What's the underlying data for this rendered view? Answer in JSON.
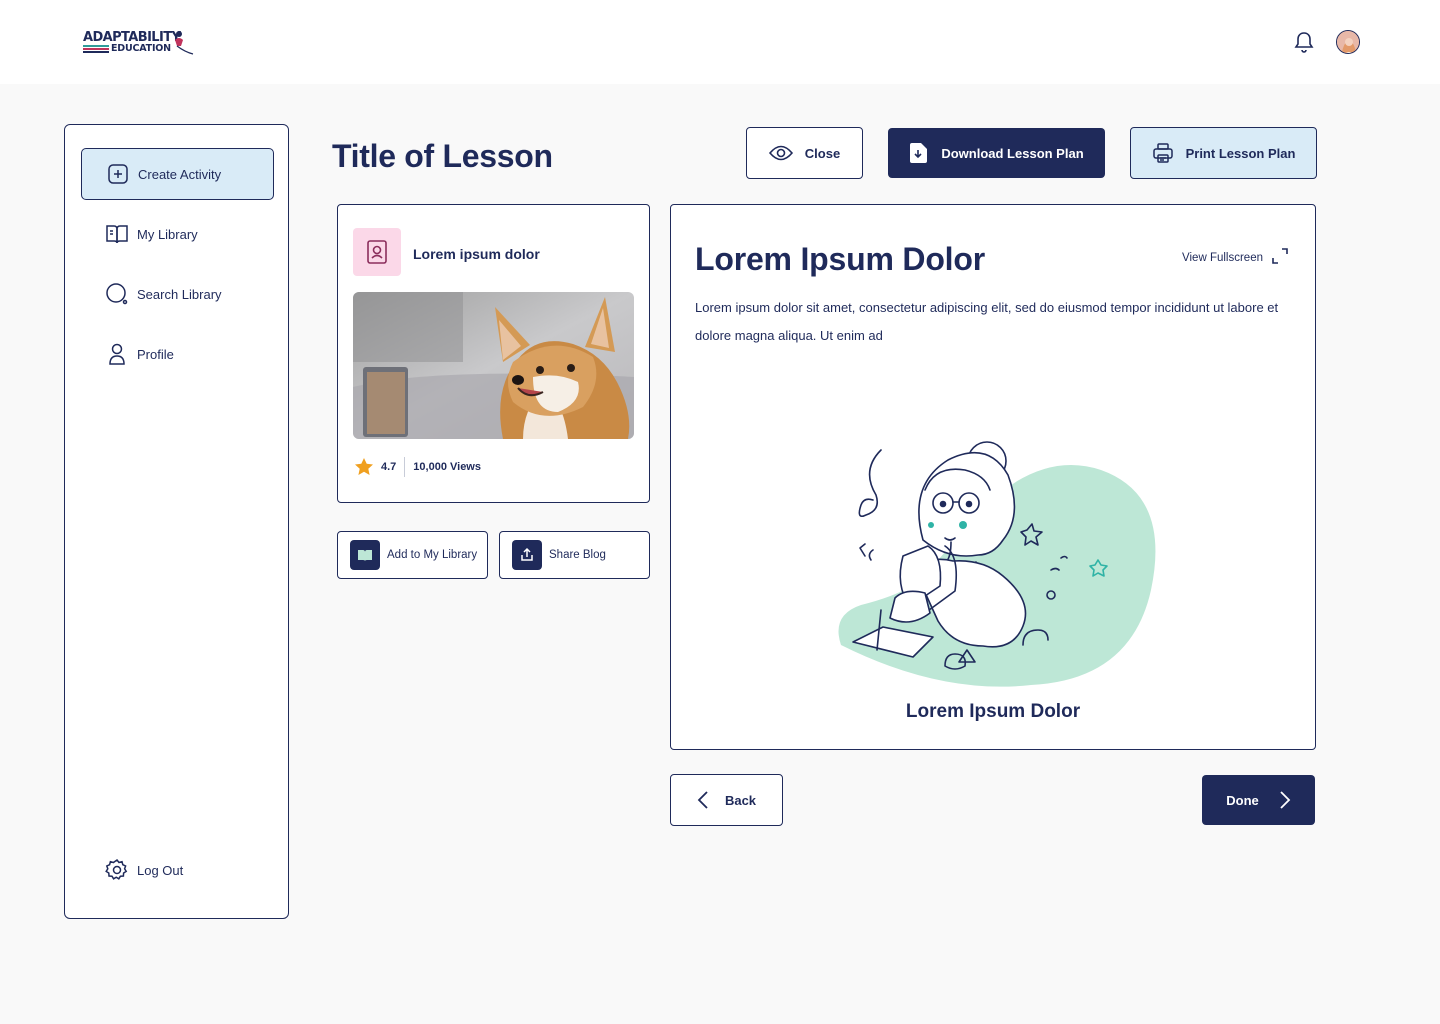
{
  "brand": {
    "logo_line1": "ADAPTABILITY",
    "logo_line2": "EDUCATION",
    "colors": {
      "navy": "#1f2a5a",
      "light_blue": "#d9ebf7",
      "mint": "#bde7d6",
      "pink": "#fbd8e8",
      "teal_bar": "#2f9c9a",
      "red_bar": "#c0335c"
    }
  },
  "header": {
    "notification_icon": "bell-icon",
    "avatar": "user-avatar"
  },
  "sidebar": {
    "items": [
      {
        "label": "Create Activity",
        "icon": "plus-square-icon",
        "active": true
      },
      {
        "label": "My Library",
        "icon": "book-icon",
        "active": false
      },
      {
        "label": "Search Library",
        "icon": "search-icon",
        "active": false
      },
      {
        "label": "Profile",
        "icon": "user-icon",
        "active": false
      }
    ],
    "logout": {
      "label": "Log Out",
      "icon": "gear-icon"
    }
  },
  "main": {
    "title": "Title of Lesson",
    "actions": {
      "close": "Close",
      "download": "Download Lesson Plan",
      "print": "Print Lesson Plan"
    }
  },
  "card": {
    "title": "Lorem ipsum dolor",
    "badge_icon": "contact-book-icon",
    "image": "corgi-photo",
    "rating": "4.7",
    "views": "10,000 Views"
  },
  "card_actions": {
    "add": "Add to My Library",
    "share": "Share Blog"
  },
  "panel": {
    "title": "Lorem Ipsum Dolor",
    "fullscreen": "View Fullscreen",
    "body": "Lorem ipsum dolor sit amet, consectetur adipiscing elit, sed do eiusmod tempor incididunt ut labore et dolore magna aliqua. Ut enim ad",
    "illustration": "girl-reading-illustration",
    "caption": "Lorem Ipsum Dolor"
  },
  "nav": {
    "back": "Back",
    "done": "Done"
  }
}
